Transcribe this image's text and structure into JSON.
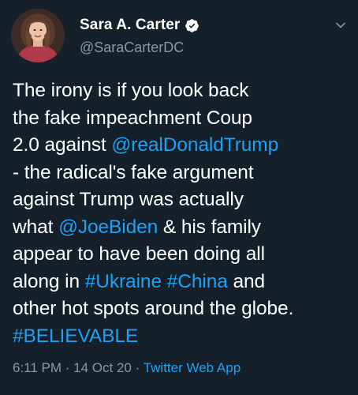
{
  "user": {
    "display_name": "Sara A. Carter",
    "handle": "@SaraCarterDC"
  },
  "tweet": {
    "lines": [
      [
        {
          "text": "The irony is if you look back",
          "link": false
        }
      ],
      [
        {
          "text": "the fake impeachment Coup",
          "link": false
        }
      ],
      [
        {
          "text": "2.0 against ",
          "link": false
        },
        {
          "text": "@realDonaldTrump",
          "link": true
        }
      ],
      [
        {
          "text": "- the radical's fake argument",
          "link": false
        }
      ],
      [
        {
          "text": "against Trump was actually",
          "link": false
        }
      ],
      [
        {
          "text": "what ",
          "link": false
        },
        {
          "text": "@JoeBiden",
          "link": true
        },
        {
          "text": " & his family",
          "link": false
        }
      ],
      [
        {
          "text": "appear to have been doing all",
          "link": false
        }
      ],
      [
        {
          "text": "along in ",
          "link": false
        },
        {
          "text": "#Ukraine",
          "link": true
        },
        {
          "text": " ",
          "link": false
        },
        {
          "text": "#China",
          "link": true
        },
        {
          "text": " and",
          "link": false
        }
      ],
      [
        {
          "text": "other hot spots around the globe.",
          "link": false
        }
      ],
      [
        {
          "text": "#BELIEVABLE",
          "link": true
        }
      ]
    ]
  },
  "meta": {
    "time": "6:11 PM",
    "separator_1": " · ",
    "date": "14 Oct 20",
    "separator_2": " · ",
    "app": "Twitter Web App"
  },
  "icons": {
    "verified": "verified-badge-icon",
    "menu": "chevron-down-icon"
  },
  "colors": {
    "background": "#15202b",
    "link": "#1da1f2",
    "secondary_text": "#8899a6"
  }
}
